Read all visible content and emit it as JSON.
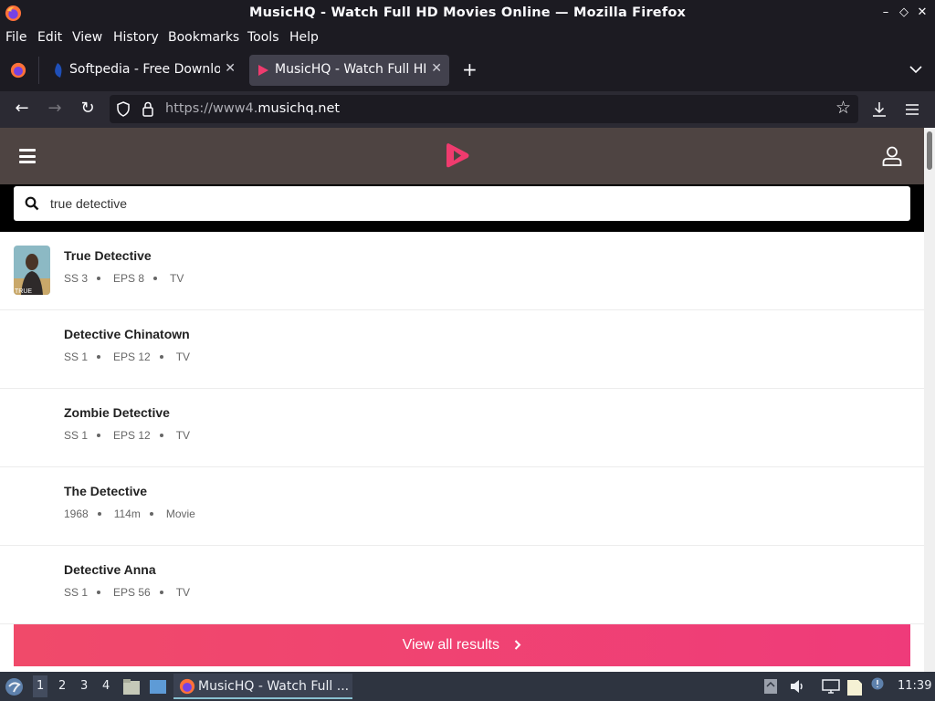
{
  "window": {
    "title": "MusicHQ - Watch Full HD Movies Online — Mozilla Firefox",
    "controls": [
      "–",
      "◇",
      "✕"
    ]
  },
  "menu": [
    "File",
    "Edit",
    "View",
    "History",
    "Bookmarks",
    "Tools",
    "Help"
  ],
  "tabs": [
    {
      "label": "Softpedia - Free Downloa",
      "active": false
    },
    {
      "label": "MusicHQ - Watch Full HD",
      "active": true
    }
  ],
  "url": {
    "prefix": "https://www4.",
    "domain": "musichq.net"
  },
  "search": {
    "value": "true detective"
  },
  "results": [
    {
      "title": "True Detective",
      "meta": [
        "SS 3",
        "EPS 8",
        "TV"
      ],
      "has_thumb": true
    },
    {
      "title": "Detective Chinatown",
      "meta": [
        "SS 1",
        "EPS 12",
        "TV"
      ],
      "has_thumb": false
    },
    {
      "title": "Zombie Detective",
      "meta": [
        "SS 1",
        "EPS 12",
        "TV"
      ],
      "has_thumb": false
    },
    {
      "title": "The Detective",
      "meta": [
        "1968",
        "114m",
        "Movie"
      ],
      "has_thumb": false
    },
    {
      "title": "Detective Anna",
      "meta": [
        "SS 1",
        "EPS 56",
        "TV"
      ],
      "has_thumb": false
    }
  ],
  "view_all": {
    "label": "View all results"
  },
  "taskbar": {
    "workspaces": [
      "1",
      "2",
      "3",
      "4"
    ],
    "task_label": "MusicHQ - Watch Full ...",
    "clock": "11:39"
  },
  "colors": {
    "site_header": "#4e4442",
    "brand_pink": "#ef3b6e",
    "browser_dark": "#1c1b22",
    "toolbar": "#2b2a33"
  }
}
